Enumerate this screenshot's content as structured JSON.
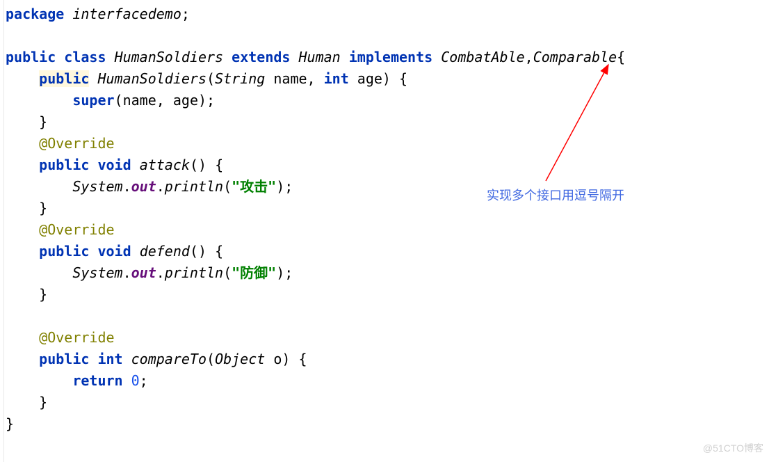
{
  "code": {
    "package_kw": "package",
    "package_name": "interfacedemo",
    "public_kw": "public",
    "class_kw": "class",
    "class_name": "HumanSoldiers",
    "extends_kw": "extends",
    "super_class": "Human",
    "implements_kw": "implements",
    "interface1": "CombatAble",
    "interface2": "Comparable",
    "constructor_name": "HumanSoldiers",
    "string_type": "String",
    "param_name": "name",
    "int_kw": "int",
    "param_age": "age",
    "super_kw": "super",
    "override_ann": "@Override",
    "void_kw": "void",
    "attack_method": "attack",
    "defend_method": "defend",
    "compareTo_method": "compareTo",
    "object_type": "Object",
    "param_o": "o",
    "system_cls": "System",
    "out_field": "out",
    "println_method": "println",
    "attack_str": "\"攻击\"",
    "defend_str": "\"防御\"",
    "return_kw": "return",
    "zero": "0",
    "brace_open": "{",
    "brace_close": "}",
    "paren_open": "(",
    "paren_close": ")",
    "semicolon": ";",
    "comma": ",",
    "dot": "."
  },
  "annotation": "实现多个接口用逗号隔开",
  "watermark": "@51CTO博客"
}
